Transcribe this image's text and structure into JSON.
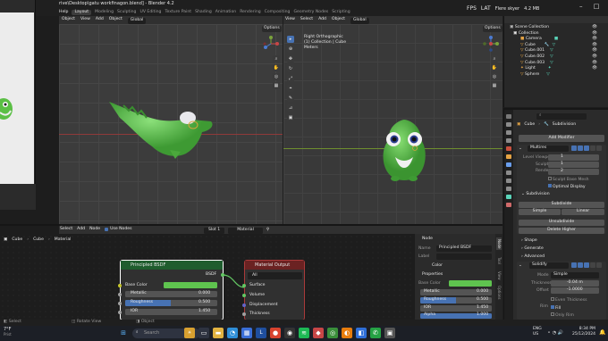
{
  "window": {
    "title": "rive\\Desktop\\gatu workfinagon.blend] - Blender 4.2",
    "fps_label": "FPS",
    "lat_label": "LAT",
    "weather": "Flere skyer",
    "size_label": "4.2 MB"
  },
  "menu": {
    "help": "Help",
    "layout": "Layout",
    "tabs": [
      "Modeling",
      "Sculpting",
      "UV Editing",
      "Texture Paint",
      "Shading",
      "Animation",
      "Rendering",
      "Compositing",
      "Geometry Nodes",
      "Scripting"
    ]
  },
  "viewport_left": {
    "menu": [
      "Object",
      "View",
      "Add",
      "Object"
    ],
    "shading": "Global",
    "options": "Options"
  },
  "viewport_right": {
    "menu": [
      "View",
      "Select",
      "Add",
      "Object"
    ],
    "shading": "Global",
    "options": "Options",
    "info_line1": "Right Orthographic",
    "info_line2": "(1) Collection | Cube",
    "info_line3": "Meters"
  },
  "node_editor": {
    "menu": [
      "Select",
      "Add",
      "Node"
    ],
    "use_nodes_label": "Use Nodes",
    "slot": "Slot 1",
    "material_name": "Material",
    "breadcrumb": [
      "Cube",
      "Cube",
      "Material"
    ]
  },
  "node_bsdf": {
    "title": "Principled BSDF",
    "output": "BSDF",
    "inputs": [
      {
        "label": "Base Color",
        "value": ""
      },
      {
        "label": "Metallic",
        "value": "0.000"
      },
      {
        "label": "Roughness",
        "value": "0.500"
      },
      {
        "label": "IOR",
        "value": "1.450"
      }
    ]
  },
  "node_output": {
    "title": "Material Output",
    "target": "All",
    "inputs": [
      "Surface",
      "Volume",
      "Displacement",
      "Thickness"
    ]
  },
  "node_sidebar": {
    "section_node": "Node",
    "name_label": "Name",
    "name_value": "Principled BSDF",
    "label_label": "Label",
    "color_label": "Color",
    "section_props": "Properties",
    "base_color_label": "Base Color",
    "rows": [
      {
        "label": "Metallic",
        "value": "0.000"
      },
      {
        "label": "Roughness",
        "value": "0.500"
      },
      {
        "label": "IOR",
        "value": "1.450"
      },
      {
        "label": "Alpha",
        "value": "1.000"
      }
    ],
    "tabs": [
      "Node",
      "Tool",
      "View",
      "Options"
    ]
  },
  "outliner": {
    "title": "Scene Collection",
    "items": [
      "Collection",
      "Camera",
      "Cube",
      "Cube.001",
      "Cube.002",
      "Cube.003",
      "Light",
      "Sphere"
    ]
  },
  "properties": {
    "object": "Cube",
    "modifier": "Subdivision",
    "add_modifier": "Add Modifier",
    "multires_name": "Multires",
    "level_viewport_label": "Level Viewport",
    "level_viewport_value": "1",
    "sculpt_label": "Sculpt",
    "sculpt_value": "1",
    "render_label": "Render",
    "render_value": "2",
    "sculpt_base_mesh": "Sculpt Base Mesh",
    "optimal_display": "Optimal Display",
    "subdivision_section": "Subdivision",
    "subdivide": "Subdivide",
    "simple": "Simple",
    "linear": "Linear",
    "unsubdivide": "Unsubdivide",
    "delete_higher": "Delete Higher",
    "shape_label": "Shape",
    "generate_label": "Generate",
    "advanced_label": "Advanced",
    "solidify_name": "Solidify",
    "mode_label": "Mode",
    "mode_value": "Simple",
    "thickness_label": "Thickness",
    "thickness_value": "-0.04 m",
    "offset_label": "Offset",
    "offset_value": "-1.0000",
    "even_thickness": "Even Thickness",
    "rim_label": "Rim",
    "fill_label": "Fill",
    "only_rim": "Only Rim"
  },
  "statusbar": {
    "select": "Select",
    "rotate_view": "Rotate View",
    "object": "Object"
  },
  "taskbar": {
    "weather_temp": "7°F",
    "weather_text": "Prist",
    "search_placeholder": "Search",
    "lang": "ENG",
    "lang2": "US",
    "time": "8:34 PM",
    "date": "25/12/2024"
  },
  "colors": {
    "accent": "#4772b3",
    "crocodile": "#5fc44f",
    "bsdf_header": "#1f5d2e",
    "output_header": "#6b2222"
  }
}
